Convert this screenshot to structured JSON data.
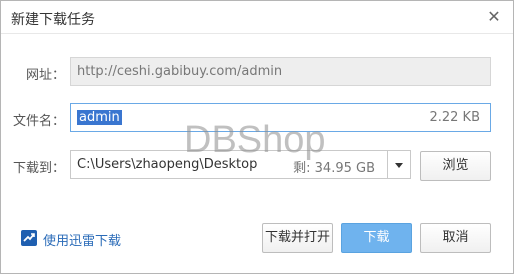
{
  "dialog": {
    "title": "新建下载任务",
    "close_symbol": "✕"
  },
  "form": {
    "url_label": "网址：",
    "url_value": "http://ceshi.gabibuy.com/admin",
    "filename_label": "文件名：",
    "filename_value": "admin",
    "file_size": "2.22 KB",
    "saveto_label": "下载到：",
    "saveto_value": "C:\\Users\\zhaopeng\\Desktop",
    "free_space": "剩: 34.95 GB",
    "browse_label": "浏览"
  },
  "footer": {
    "thunder_label": "使用迅雷下载",
    "download_open_label": "下载并打开",
    "download_label": "下载",
    "cancel_label": "取消"
  },
  "watermark": "DBShop",
  "colors": {
    "primary_button": "#6fb3ee",
    "selection": "#3a76d0",
    "link": "#2a6bb8"
  }
}
